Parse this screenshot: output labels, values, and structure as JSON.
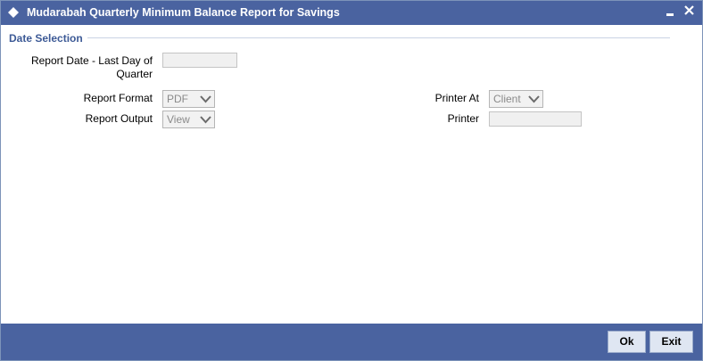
{
  "window": {
    "title": "Mudarabah Quarterly Minimum Balance Report for Savings",
    "minimize_icon": "minimize-icon",
    "close_icon": "close-icon",
    "title_icon": "diamond-icon"
  },
  "section": {
    "legend": "Date Selection"
  },
  "fields": {
    "report_date_label_line1": "Report Date - Last Day of",
    "report_date_label_line2": "Quarter",
    "report_date_value": "",
    "report_format_label": "Report Format",
    "report_format_value": "PDF",
    "report_output_label": "Report Output",
    "report_output_value": "View",
    "printer_at_label": "Printer At",
    "printer_at_value": "Client",
    "printer_label": "Printer",
    "printer_value": ""
  },
  "footer": {
    "ok_label": "Ok",
    "exit_label": "Exit"
  },
  "colors": {
    "titlebar": "#4a63a0",
    "legend": "#3d5a96",
    "footer": "#4a63a0"
  }
}
